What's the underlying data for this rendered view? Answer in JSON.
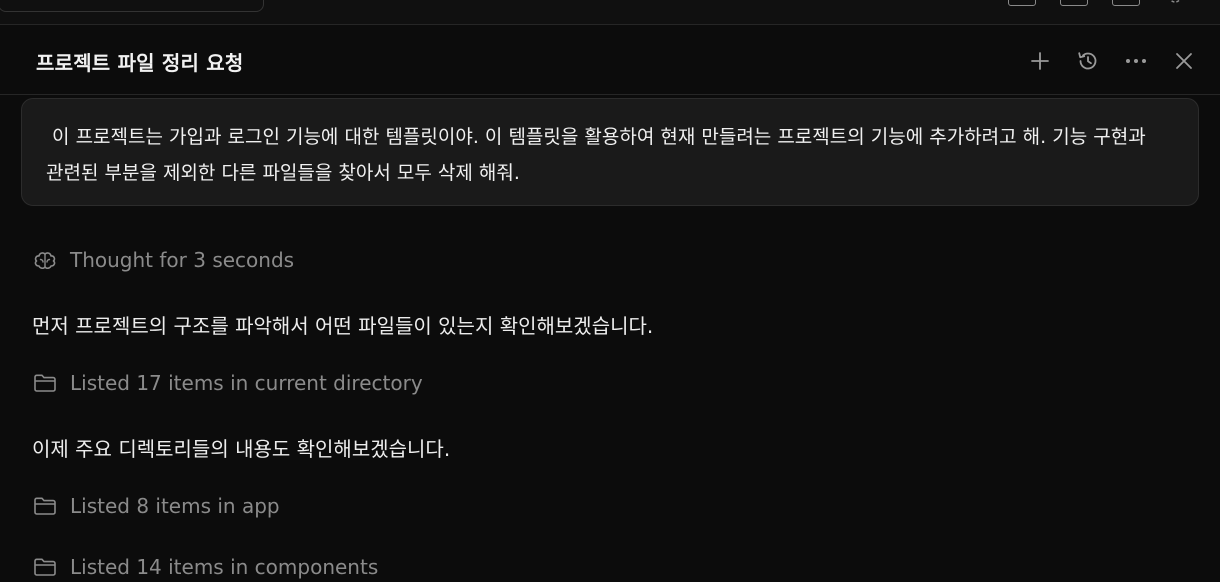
{
  "panel": {
    "title": "프로젝트 파일 정리 요청"
  },
  "header_actions": {
    "icons": [
      "plus-icon",
      "history-icon",
      "more-icon",
      "close-icon"
    ]
  },
  "user_message": {
    "text": " 이 프로젝트는 가입과 로그인 기능에 대한 템플릿이야. 이 템플릿을 활용하여 현재 만들려는 프로젝트의 기능에 추가하려고 해. 기능 구현과 관련된 부분을 제외한 다른 파일들을 찾아서 모두 삭제 해줘."
  },
  "transcript": {
    "thought": "Thought for 3 seconds",
    "assistant_1": "먼저 프로젝트의 구조를 파악해서 어떤 파일들이 있는지 확인해보겠습니다.",
    "tool_1": "Listed 17 items in current directory",
    "assistant_2": "이제 주요 디렉토리들의 내용도 확인해보겠습니다.",
    "tool_2": "Listed 8 items in app",
    "tool_3": "Listed 14 items in components"
  },
  "colors": {
    "background": "#0c0c0c",
    "bubble": "#1a1a1a",
    "muted": "#8b8b8b",
    "text": "#ededed"
  }
}
